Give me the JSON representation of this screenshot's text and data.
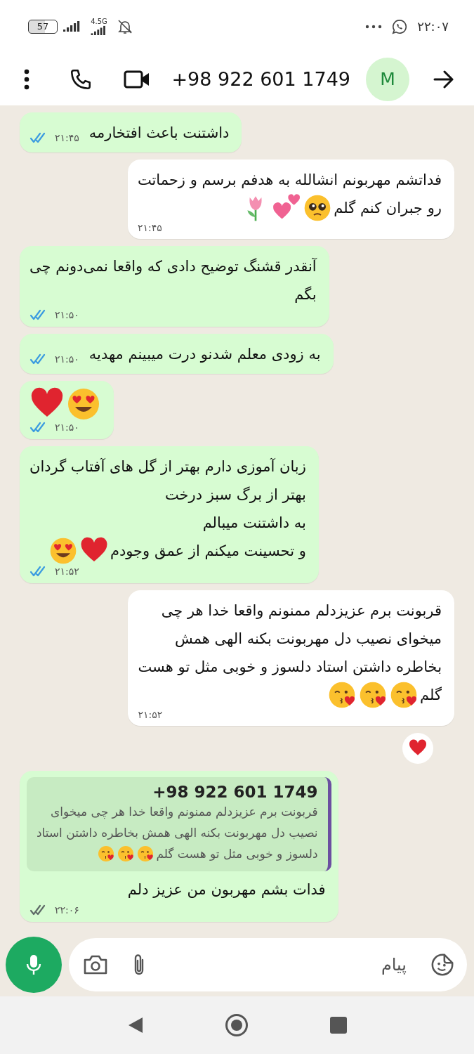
{
  "status_bar": {
    "time": "۲۲:۰۷",
    "battery": "57",
    "network": "4.5G",
    "silent": true
  },
  "header": {
    "title": "+98 922 601 1749",
    "avatar": "M"
  },
  "messages": [
    {
      "kind": "outgoing",
      "lines": [
        "داشتنت باعث افتخارمه"
      ],
      "time": "۲۱:۴۵",
      "read": true
    },
    {
      "kind": "incoming",
      "lines": [
        "فداتشم مهربونم انشالله به هدفم برسم و زحماتت",
        "رو جبران کنم گلم"
      ],
      "emojis": [
        {
          "kind": "pleading"
        },
        {
          "kind": "two-hearts"
        },
        {
          "kind": "tulip"
        }
      ],
      "time": "۲۱:۴۵"
    },
    {
      "kind": "outgoing",
      "lines": [
        "آنقدر قشنگ توضیح دادی که واقعا نمی‌دونم چی",
        "بگم"
      ],
      "time": "۲۱:۵۰",
      "read": true
    },
    {
      "kind": "outgoing",
      "lines": [
        "به زودی معلم شدنو درت میبینم مهدیه"
      ],
      "time": "۲۱:۵۰",
      "read": true
    },
    {
      "kind": "outgoing",
      "emojis": [
        {
          "kind": "heart-eyes"
        },
        {
          "kind": "heart"
        }
      ],
      "time": "۲۱:۵۰",
      "read": true
    },
    {
      "kind": "outgoing",
      "lines": [
        "زبان آموزی دارم بهتر از گل های آفتاب گردان",
        "بهتر از برگ سبز درخت",
        "به داشتنت میبالم",
        "و تحسینت میکنم از عمق وجودم"
      ],
      "emojis": [
        {
          "kind": "heart"
        },
        {
          "kind": "heart-eyes"
        }
      ],
      "time": "۲۱:۵۲",
      "read": true
    },
    {
      "kind": "incoming",
      "lines": [
        "قربونت برم عزیزدلم ممنونم واقعا خدا هر چی",
        "میخوای نصیب دل مهربونت بکنه الهی همش",
        "بخاطره داشتن استاد دلسوز و خوبی مثل تو هست",
        "گلم"
      ],
      "emojis": [
        {
          "kind": "kiss"
        },
        {
          "kind": "kiss"
        },
        {
          "kind": "kiss"
        }
      ],
      "time": "۲۱:۵۲",
      "reaction": {
        "kind": "heart"
      }
    },
    {
      "kind": "outgoing",
      "quote": {
        "author": "+98 922 601 1749",
        "lines": [
          "قربونت برم عزیزدلم ممنونم واقعا خدا هر چی میخوای",
          "نصیب دل مهربونت بکنه الهی همش بخاطره داشتن استاد",
          "دلسوز و خوبی مثل تو هست گلم"
        ],
        "emojis": [
          {
            "kind": "kiss"
          },
          {
            "kind": "kiss"
          },
          {
            "kind": "kiss"
          }
        ],
        "color": "#6b4fa0"
      },
      "lines": [
        "فدات بشم مهربون من عزیز دلم"
      ],
      "time": "۲۲:۰۶",
      "read": false
    }
  ],
  "composer": {
    "placeholder": "پیام"
  }
}
